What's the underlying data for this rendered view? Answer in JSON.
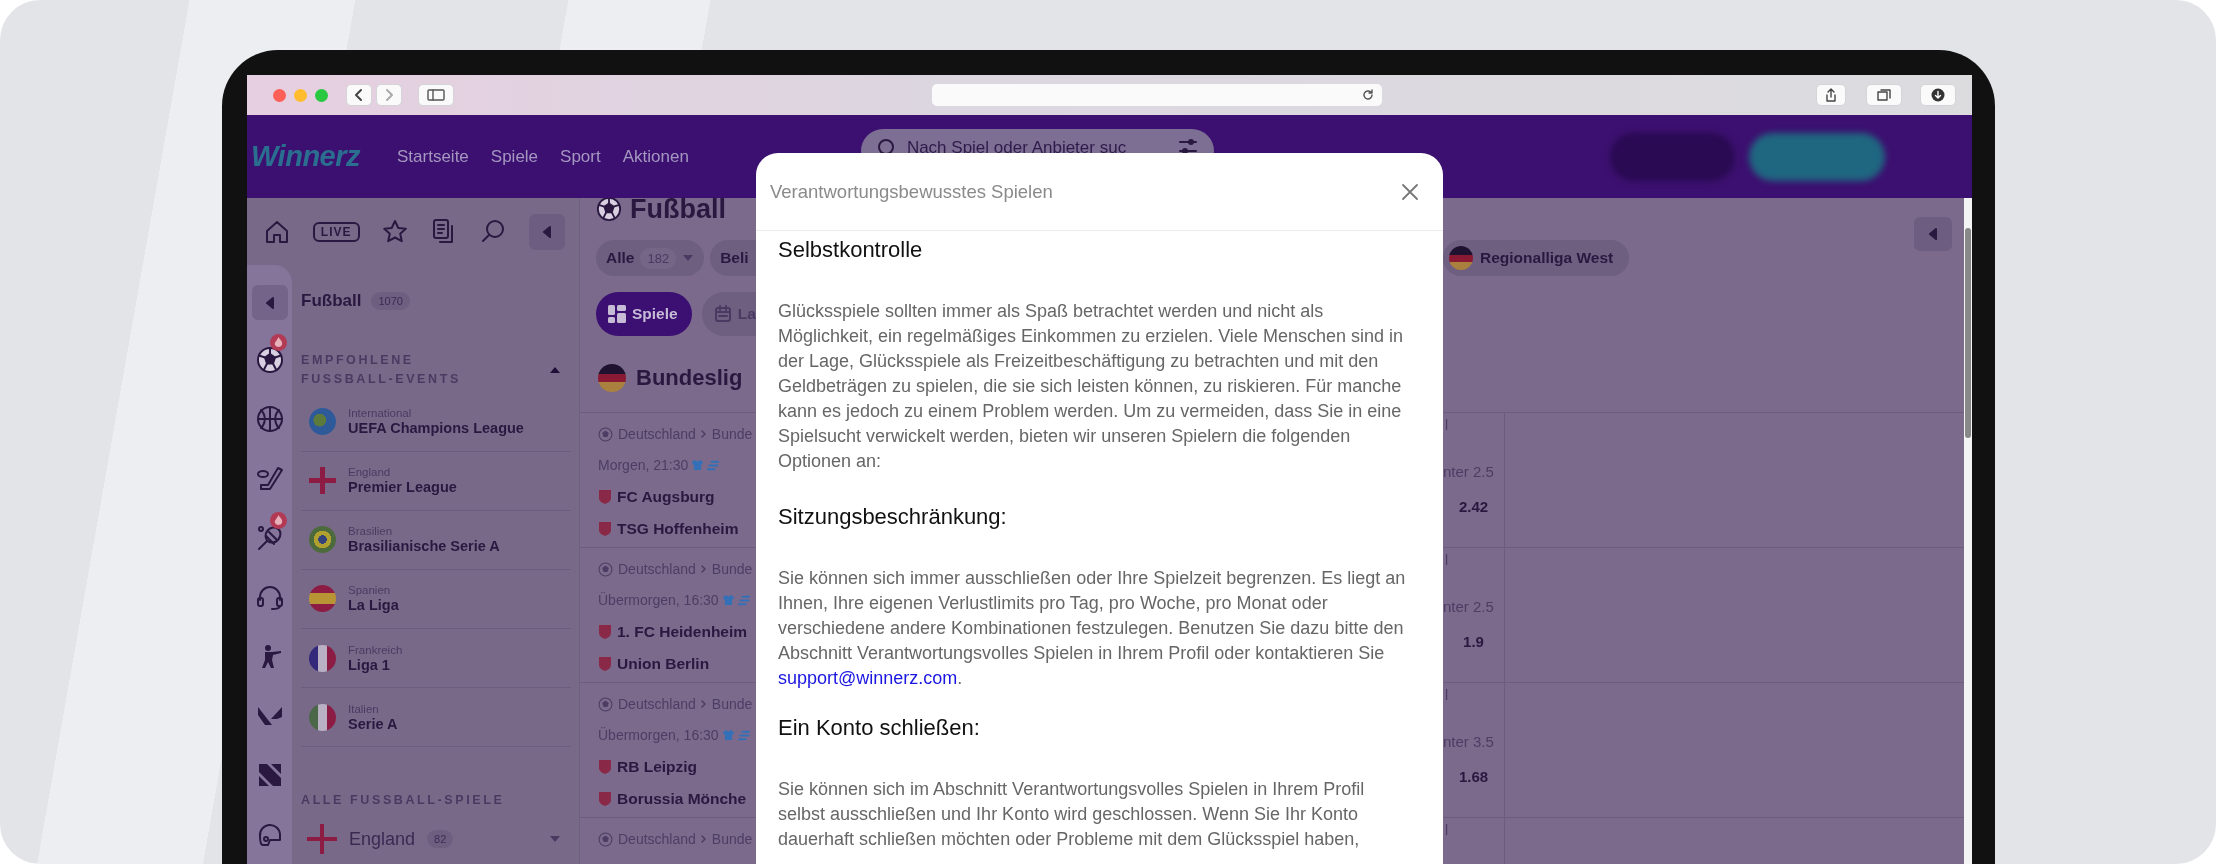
{
  "header": {
    "logo": "Winnerz",
    "nav": [
      {
        "label": "Startseite"
      },
      {
        "label": "Spiele"
      },
      {
        "label": "Sport"
      },
      {
        "label": "Aktionen"
      }
    ],
    "search": {
      "placeholder": "Nach Spiel oder Anbieter suc"
    }
  },
  "sidebar": {
    "live_label": "LIVE",
    "rail": [
      {
        "kind": "soccer",
        "hot": true
      },
      {
        "kind": "basketball",
        "hot": false
      },
      {
        "kind": "hockey",
        "hot": false
      },
      {
        "kind": "tennis",
        "hot": true
      },
      {
        "kind": "headset",
        "hot": false
      },
      {
        "kind": "shooter",
        "hot": false
      },
      {
        "kind": "valorant",
        "hot": false
      },
      {
        "kind": "slash",
        "hot": false
      },
      {
        "kind": "helmet",
        "hot": false
      }
    ],
    "sport": {
      "title": "Fußball",
      "count": "1070"
    },
    "featured": {
      "title": "EMPFOHLENE FUSSBALL-EVENTS",
      "expanded": true,
      "items": [
        {
          "kind": "globe",
          "country": "International",
          "league": "UEFA Champions League"
        },
        {
          "kind": "england",
          "country": "England",
          "league": "Premier League"
        },
        {
          "kind": "brazil",
          "country": "Brasilien",
          "league": "Brasilianische Serie A"
        },
        {
          "kind": "spain",
          "country": "Spanien",
          "league": "La Liga"
        },
        {
          "kind": "france",
          "country": "Frankreich",
          "league": "Liga 1"
        },
        {
          "kind": "italy",
          "country": "Italien",
          "league": "Serie A"
        }
      ]
    },
    "all_matches": {
      "title": "ALLE FUSSBALL-SPIELE",
      "items": [
        {
          "kind": "england",
          "label": "England",
          "count": "82",
          "expanded": false
        }
      ]
    }
  },
  "main": {
    "title": "Fußball",
    "filters": [
      {
        "label": "Alle",
        "count": "182",
        "dropdown": true
      },
      {
        "label": "Beli"
      }
    ],
    "right_filters": [
      {
        "label": "Regionalliga West",
        "kind": "germany"
      }
    ],
    "tabs": [
      {
        "label": "Spiele",
        "kind": "games",
        "selected": true
      },
      {
        "label": "La",
        "kind": "calendar",
        "selected": false
      }
    ],
    "league": {
      "kind": "germany",
      "title": "Bundeslig"
    },
    "matches": [
      {
        "country": "Deutschland",
        "league": "Bunde",
        "time": "Morgen, 21:30",
        "home": "FC Augsburg",
        "away": "TSG Hoffenheim",
        "market_fragment": "l",
        "market": "nter 2.5",
        "odds": "2.42"
      },
      {
        "country": "Deutschland",
        "league": "Bunde",
        "time": "Übermorgen, 16:30",
        "home": "1. FC Heidenheim",
        "away": "Union Berlin",
        "market_fragment": "l",
        "market": "nter 2.5",
        "odds": "1.9"
      },
      {
        "country": "Deutschland",
        "league": "Bunde",
        "time": "Übermorgen, 16:30",
        "home": "RB Leipzig",
        "away": "Borussia Mönche",
        "market_fragment": "l",
        "market": "nter 3.5",
        "odds": "1.68"
      },
      {
        "country": "Deutschland",
        "league": "Bunde",
        "market_fragment": "l"
      }
    ]
  },
  "modal": {
    "title": "Verantwortungsbewusstes Spielen",
    "sections": [
      {
        "heading": "Selbstkontrolle",
        "text": "Glücksspiele sollten immer als Spaß betrachtet werden und nicht als Möglichkeit, ein regelmäßiges Einkommen zu erzielen. Viele Menschen sind in der Lage, Glücksspiele als Freizeitbeschäftigung zu betrachten und mit den Geldbeträgen zu spielen, die sie sich leisten können, zu riskieren. Für manche kann es jedoch zu einem Problem werden. Um zu vermeiden, dass Sie in eine Spielsucht verwickelt werden, bieten wir unseren Spielern die folgenden Optionen an:"
      },
      {
        "heading": "Sitzungsbeschränkung:",
        "text": "Sie können sich immer ausschließen oder Ihre Spielzeit begrenzen. Es liegt an Ihnen, Ihre eigenen Verlustlimits pro Tag, pro Woche, pro Monat oder verschiedene andere Kombinationen festzulegen. Benutzen Sie dazu bitte den Abschnitt Verantwortungsvolles Spielen in Ihrem Profil oder kontaktieren Sie ",
        "link": "support@winnerz.com",
        "after": "."
      },
      {
        "heading": "Ein Konto schließen:",
        "text": "Sie können sich im Abschnitt Verantwortungsvolles Spielen in Ihrem Profil selbst ausschließen und Ihr Konto wird geschlossen. Wenn Sie Ihr Konto dauerhaft schließen möchten oder Probleme mit dem Glücksspiel haben,"
      }
    ]
  }
}
